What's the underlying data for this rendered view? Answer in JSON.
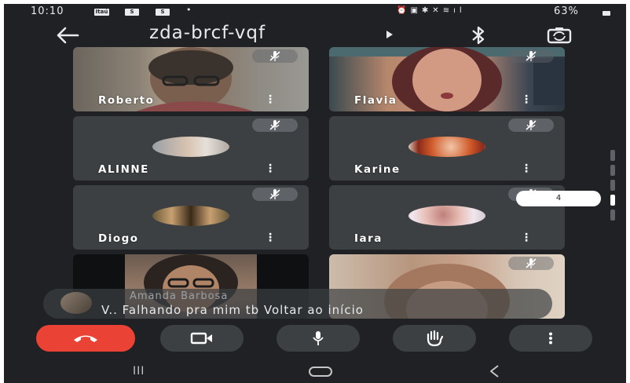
{
  "status_bar": {
    "time": "10:10",
    "badges": [
      "Itaú",
      "S",
      "S"
    ],
    "dot": "•",
    "battery": "63%"
  },
  "header": {
    "meeting_code": "zda-brcf-vqf",
    "caret": "▸"
  },
  "participants": [
    {
      "name": "Roberto",
      "type": "video",
      "muted": true
    },
    {
      "name": "Flavia",
      "type": "video",
      "muted": true
    },
    {
      "name": "ALINNE",
      "type": "avatar",
      "muted": true
    },
    {
      "name": "Karine",
      "type": "avatar",
      "muted": true
    },
    {
      "name": "Diogo",
      "type": "avatar",
      "muted": true
    },
    {
      "name": "Iara",
      "type": "avatar",
      "muted": true
    },
    {
      "name": "",
      "type": "video",
      "muted": false
    },
    {
      "name": "",
      "type": "video",
      "muted": true
    }
  ],
  "more_options_glyph": "⋮",
  "page_indicator": {
    "label": "4",
    "total_pages": 5,
    "current_page": 4
  },
  "chat_toast": {
    "sender": "Amanda Barbosa",
    "message": "V.. Falhando pra mim tb Voltar ao início"
  },
  "controls": {
    "end_call": "end-call",
    "camera": "camera",
    "microphone": "microphone",
    "raise_hand": "raise-hand",
    "more": "more-options"
  },
  "colors": {
    "background": "#202124",
    "tile": "#3c4043",
    "end_call": "#ea4335",
    "text": "#ffffff"
  },
  "nav_bar": {
    "recents": "III",
    "back": "<"
  }
}
